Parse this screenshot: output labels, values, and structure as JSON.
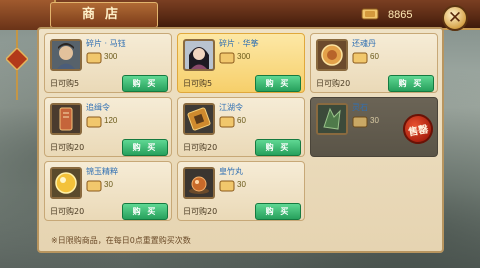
{
  "header": {
    "title": "商店",
    "currency_icon": "coin-scroll-icon",
    "currency_value": "8865",
    "close_icon": "close-icon"
  },
  "colors": {
    "buy_button": "#2fb56a",
    "item_name": "#2f6fb3",
    "sold_seal": "#c2301a"
  },
  "items": [
    {
      "name": "碎片 · 马钰",
      "price": "300",
      "limit": "日可购5",
      "buy_label": "购 买",
      "icon": "portrait-mayu-icon",
      "selected": false,
      "sold_out": false
    },
    {
      "name": "碎片 · 华筝",
      "price": "300",
      "limit": "日可购5",
      "buy_label": "购 买",
      "icon": "portrait-huazheng-icon",
      "selected": true,
      "sold_out": false
    },
    {
      "name": "还魂丹",
      "price": "60",
      "limit": "日可购20",
      "buy_label": "购 买",
      "icon": "pill-icon",
      "selected": false,
      "sold_out": false
    },
    {
      "name": "追缉令",
      "price": "120",
      "limit": "日可购20",
      "buy_label": "购 买",
      "icon": "warrant-icon",
      "selected": false,
      "sold_out": false
    },
    {
      "name": "江湖令",
      "price": "60",
      "limit": "日可购20",
      "buy_label": "购 买",
      "icon": "token-icon",
      "selected": false,
      "sold_out": false
    },
    {
      "name": "灵石",
      "price": "30",
      "limit": "",
      "buy_label": "",
      "sold_label": "售罄",
      "icon": "spirit-stone-icon",
      "selected": false,
      "sold_out": true
    },
    {
      "name": "锦玉精粹",
      "price": "30",
      "limit": "日可购20",
      "buy_label": "购 买",
      "icon": "jade-essence-icon",
      "selected": false,
      "sold_out": false
    },
    {
      "name": "皇竹丸",
      "price": "30",
      "limit": "日可购20",
      "buy_label": "购 买",
      "icon": "bamboo-pill-icon",
      "selected": false,
      "sold_out": false
    }
  ],
  "footer_note": "※日限购商品，在每日0点重置购买次数"
}
